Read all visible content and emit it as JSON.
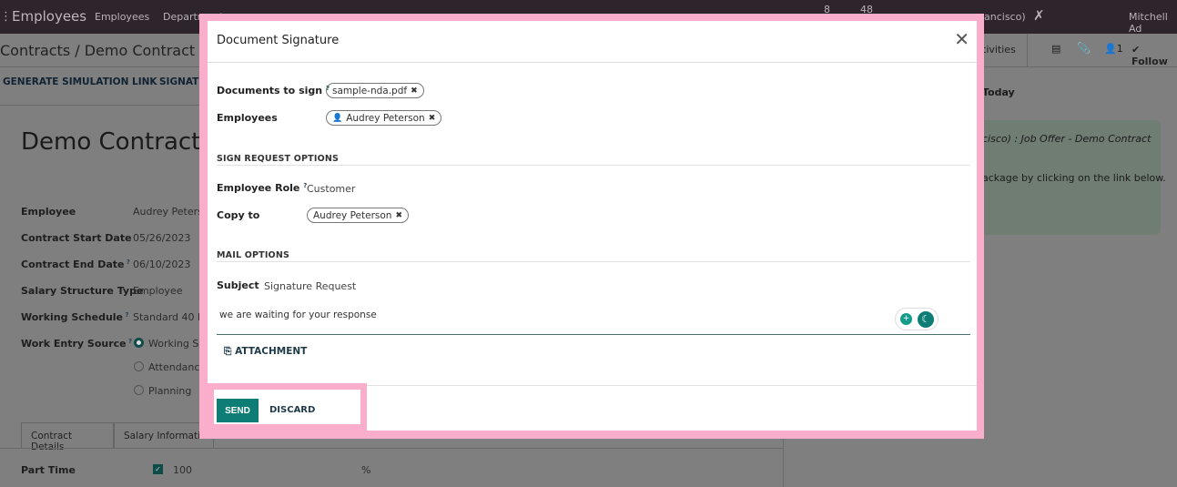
{
  "navbar": {
    "app": "Employees",
    "menu": [
      "Employees",
      "Departments"
    ],
    "chat_count": "8",
    "activity_count": "48",
    "company_partial": "ancisco)",
    "user_partial": "Mitchell Ad"
  },
  "background": {
    "breadcrumb": "Contracts / Demo Contract",
    "actions": [
      "GENERATE SIMULATION LINK",
      "SIGNATU"
    ],
    "record_title": "Demo Contract",
    "fields": [
      {
        "label": "Employee",
        "value": "Audrey Peterso",
        "help": false
      },
      {
        "label": "Contract Start Date",
        "value": "05/26/2023",
        "help": false
      },
      {
        "label": "Contract End Date",
        "value": "06/10/2023",
        "help": true
      },
      {
        "label": "Salary Structure Type",
        "value": "Employee",
        "help": false
      },
      {
        "label": "Working Schedule",
        "value": "Standard 40 h",
        "help": true
      },
      {
        "label": "Work Entry Source",
        "value": "",
        "help": true
      }
    ],
    "work_entry_options": [
      {
        "label": "Working Sc",
        "checked": true
      },
      {
        "label": "Attendance",
        "checked": false
      },
      {
        "label": "Planning",
        "checked": false
      }
    ],
    "tabs": [
      "Contract Details",
      "Salary Informatio"
    ],
    "part_time": {
      "label": "Part Time",
      "checked": true,
      "value": "100",
      "unit": "%"
    },
    "chatter": {
      "activities": "tivities",
      "followers": "1",
      "follow": "Follow",
      "date_sep": "Today",
      "message_line1": "cisco) : Job Offer - Demo Contract",
      "message_line2": "ackage by clicking on the link below."
    }
  },
  "dialog": {
    "title": "Document Signature",
    "documents_label": "Documents to sign",
    "documents": [
      "sample-nda.pdf"
    ],
    "employees_label": "Employees",
    "employees": [
      "Audrey Peterson"
    ],
    "sign_section": "SIGN REQUEST OPTIONS",
    "role_label": "Employee Role",
    "role_value": "Customer",
    "copy_label": "Copy to",
    "copy_to": [
      "Audrey Peterson"
    ],
    "mail_section": "MAIL OPTIONS",
    "subject_label": "Subject",
    "subject_value": "Signature Request",
    "body": "we are waiting for your response",
    "attachment": "ATTACHMENT",
    "send": "SEND",
    "discard": "DISCARD",
    "help_mark": "?",
    "remove_mark": "✖"
  },
  "colors": {
    "primary": "#0d7d75",
    "highlight": "#fbaecb",
    "navbar": "#2e242c"
  }
}
